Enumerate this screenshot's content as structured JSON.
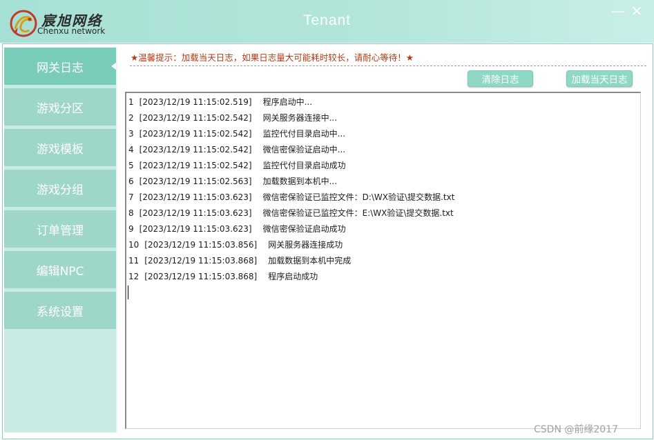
{
  "window": {
    "title": "Tenant",
    "logo_cn": "宸旭网络",
    "logo_en": "Chenxu network",
    "minimize_symbol": "—",
    "close_symbol": "✕"
  },
  "sidebar": {
    "items": [
      {
        "label": "网关日志",
        "active": true
      },
      {
        "label": "游戏分区",
        "active": false
      },
      {
        "label": "游戏模板",
        "active": false
      },
      {
        "label": "游戏分组",
        "active": false
      },
      {
        "label": "订单管理",
        "active": false
      },
      {
        "label": "编辑NPC",
        "active": false
      },
      {
        "label": "系统设置",
        "active": false
      }
    ]
  },
  "main": {
    "tip": "★温馨提示：加载当天日志，如果日志量大可能耗时较长，请耐心等待！★",
    "clear_button": "清除日志",
    "load_button": "加载当天日志",
    "log": [
      {
        "num": "1",
        "time": "[2023/12/19 11:15:02.519]",
        "msg": "程序启动中..."
      },
      {
        "num": "2",
        "time": "[2023/12/19 11:15:02.542]",
        "msg": "网关服务器连接中..."
      },
      {
        "num": "3",
        "time": "[2023/12/19 11:15:02.542]",
        "msg": "监控代付目录启动中..."
      },
      {
        "num": "4",
        "time": "[2023/12/19 11:15:02.542]",
        "msg": "微信密保验证启动中..."
      },
      {
        "num": "5",
        "time": "[2023/12/19 11:15:02.542]",
        "msg": "监控代付目录启动成功"
      },
      {
        "num": "6",
        "time": "[2023/12/19 11:15:02.563]",
        "msg": "加载数据到本机中..."
      },
      {
        "num": "7",
        "time": "[2023/12/19 11:15:03.623]",
        "msg": "微信密保验证已监控文件：D:\\WX验证\\提交数据.txt"
      },
      {
        "num": "8",
        "time": "[2023/12/19 11:15:03.623]",
        "msg": "微信密保验证已监控文件：E:\\WX验证\\提交数据.txt"
      },
      {
        "num": "9",
        "time": "[2023/12/19 11:15:03.623]",
        "msg": "微信密保验证启动成功"
      },
      {
        "num": "10",
        "time": "[2023/12/19 11:15:03.856]",
        "msg": "网关服务器连接成功"
      },
      {
        "num": "11",
        "time": "[2023/12/19 11:15:03.868]",
        "msg": "加载数据到本机中完成"
      },
      {
        "num": "12",
        "time": "[2023/12/19 11:15:03.868]",
        "msg": "程序启动成功"
      }
    ]
  },
  "watermark": "CSDN @前缘2017",
  "colors": {
    "titlebar": "#a6e0d4",
    "nav_active": "#79cdb8",
    "nav_inactive": "#9fd6ca",
    "tip_text": "#b33a12",
    "button": "#8fd8c6"
  },
  "icons": [
    "dragon-logo-icon",
    "minimize-icon",
    "close-icon",
    "star-icon"
  ]
}
